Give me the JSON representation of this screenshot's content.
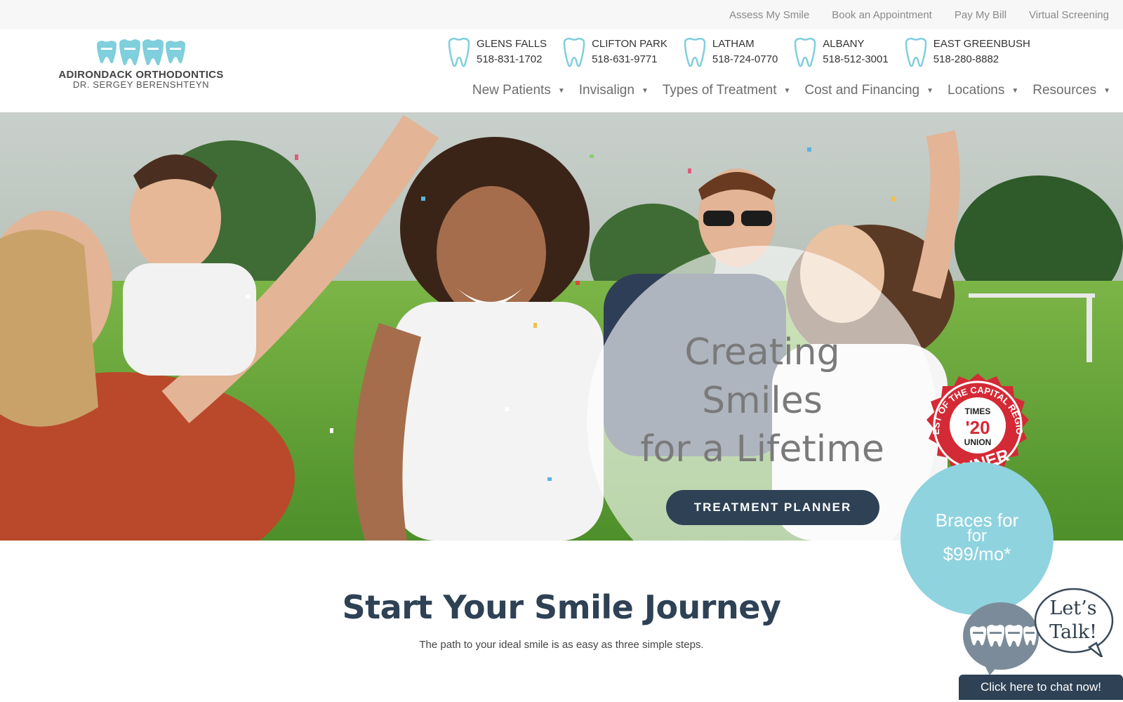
{
  "utility_nav": [
    "Assess My Smile",
    "Book an Appointment",
    "Pay My Bill",
    "Virtual Screening"
  ],
  "logo": {
    "name": "ADIRONDACK ORTHODONTICS",
    "doctor": "DR. SERGEY BERENSHTEYN"
  },
  "locations": [
    {
      "name": "GLENS FALLS",
      "phone": "518-831-1702"
    },
    {
      "name": "CLIFTON PARK",
      "phone": "518-631-9771"
    },
    {
      "name": "LATHAM",
      "phone": "518-724-0770"
    },
    {
      "name": "ALBANY",
      "phone": "518-512-3001"
    },
    {
      "name": "EAST GREENBUSH",
      "phone": "518-280-8882"
    }
  ],
  "main_nav": [
    "New Patients",
    "Invisalign",
    "Types of Treatment",
    "Cost and Financing",
    "Locations",
    "Resources"
  ],
  "hero": {
    "headline_line1": "Creating",
    "headline_line2": "Smiles",
    "headline_line3": "for a Lifetime",
    "cta": "TREATMENT PLANNER"
  },
  "award": {
    "ring_text": "BEST OF THE CAPITAL REGION",
    "brand_top": "TIMES",
    "year": "'20",
    "brand_bottom": "UNION",
    "label": "WINNER"
  },
  "offer": {
    "line1": "Braces for",
    "line2": "for",
    "line3": "$99/mo*"
  },
  "intro": {
    "title": "Start Your Smile Journey",
    "subtitle": "The path to your ideal smile is as easy as three simple steps."
  },
  "chat": {
    "bubble_line1": "Let’s",
    "bubble_line2": "Talk!",
    "bar": "Click here to chat now!"
  },
  "colors": {
    "navy": "#2e4155",
    "teal": "#8fd3df",
    "award_red": "#d42a35"
  }
}
